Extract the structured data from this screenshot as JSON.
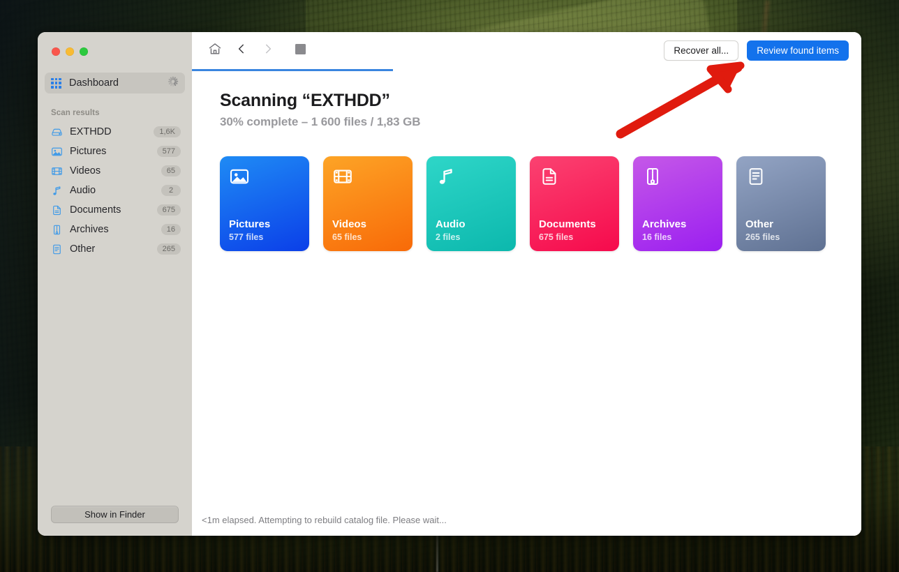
{
  "window": {
    "traffic_lights": [
      "close",
      "minimize",
      "zoom"
    ],
    "colors": {
      "accent_blue": "#1372ec",
      "progress_blue": "#3a85df",
      "sidebar_bg": "#d5d3cd",
      "annotation_red": "#e01b0e"
    }
  },
  "sidebar": {
    "dashboard": {
      "label": "Dashboard",
      "icon": "grid-icon",
      "busy_icon": "spinner-icon"
    },
    "section_label": "Scan results",
    "items": [
      {
        "label": "EXTHDD",
        "badge": "1,6K",
        "icon": "hard-drive-icon"
      },
      {
        "label": "Pictures",
        "badge": "577",
        "icon": "photo-icon"
      },
      {
        "label": "Videos",
        "badge": "65",
        "icon": "film-icon"
      },
      {
        "label": "Audio",
        "badge": "2",
        "icon": "music-note-icon"
      },
      {
        "label": "Documents",
        "badge": "675",
        "icon": "document-icon"
      },
      {
        "label": "Archives",
        "badge": "16",
        "icon": "archive-zip-icon"
      },
      {
        "label": "Other",
        "badge": "265",
        "icon": "list-document-icon"
      }
    ],
    "footer_button": "Show in Finder"
  },
  "toolbar": {
    "home_icon": "home-icon",
    "back_icon": "chevron-left-icon",
    "forward_icon": "chevron-right-icon",
    "stop_icon": "stop-square-icon",
    "recover_all_label": "Recover all...",
    "review_found_label": "Review found items"
  },
  "progress": {
    "percent": 30
  },
  "main": {
    "title": "Scanning “EXTHDD”",
    "subtitle": "30% complete – 1 600 files / 1,83 GB"
  },
  "cards": [
    {
      "title": "Pictures",
      "count": "577 files",
      "icon": "photo-icon",
      "from": "#1f8bf5",
      "to": "#0b3fe8"
    },
    {
      "title": "Videos",
      "count": "65 files",
      "icon": "film-icon",
      "from": "#fda426",
      "to": "#f86a08"
    },
    {
      "title": "Audio",
      "count": "2 files",
      "icon": "music-note-icon",
      "from": "#2ed6c8",
      "to": "#0cb8ad"
    },
    {
      "title": "Documents",
      "count": "675 files",
      "icon": "document-icon",
      "from": "#fb4271",
      "to": "#f60a4c"
    },
    {
      "title": "Archives",
      "count": "16 files",
      "icon": "archive-zip-icon",
      "from": "#c558e8",
      "to": "#9b1ff0"
    },
    {
      "title": "Other",
      "count": "265 files",
      "icon": "list-document-icon",
      "from": "#93a4c4",
      "to": "#5f7192"
    }
  ],
  "status": {
    "text": "<1m elapsed. Attempting to rebuild catalog file. Please wait..."
  },
  "annotation": {
    "type": "arrow",
    "points_to": "Review found items",
    "color": "#e01b0e"
  }
}
